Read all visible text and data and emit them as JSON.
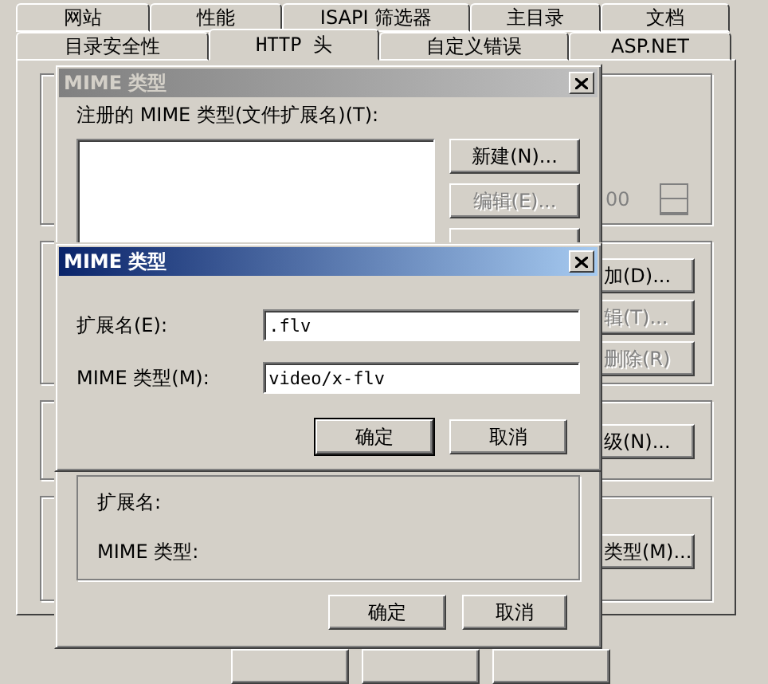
{
  "property_sheet": {
    "tabs_row1": [
      {
        "label": "网站",
        "selected": false
      },
      {
        "label": "性能",
        "selected": false
      },
      {
        "label": "ISAPI 筛选器",
        "selected": false
      },
      {
        "label": "主目录",
        "selected": false
      },
      {
        "label": "文档",
        "selected": false
      }
    ],
    "tabs_row2": [
      {
        "label": "目录安全性",
        "selected": false
      },
      {
        "label": "HTTP 头",
        "selected": true
      },
      {
        "label": "自定义错误",
        "selected": false
      },
      {
        "label": "ASP.NET",
        "selected": false
      }
    ],
    "spinner": {
      "value": "00",
      "disabled": true
    },
    "side_buttons": [
      {
        "label": "加(D)...",
        "disabled": false
      },
      {
        "label": "辑(T)...",
        "disabled": true
      },
      {
        "label": "删除(R)",
        "disabled": true
      },
      {
        "label": "级(N)...",
        "disabled": false
      },
      {
        "label": "类型(M)...",
        "disabled": false
      }
    ]
  },
  "mime_types_dialog": {
    "title": "MIME 类型",
    "active": false,
    "list_label": "注册的 MIME 类型(文件扩展名)(T):",
    "buttons": [
      {
        "label": "新建(N)...",
        "disabled": false
      },
      {
        "label": "编辑(E)...",
        "disabled": true
      }
    ],
    "details": {
      "extension_label": "扩展名:",
      "mime_label": "MIME 类型:"
    },
    "ok": "确定",
    "cancel": "取消"
  },
  "mime_type_dialog": {
    "title": "MIME 类型",
    "active": true,
    "fields": [
      {
        "label": "扩展名(E):",
        "value": ".flv"
      },
      {
        "label": "MIME 类型(M):",
        "value": "video/x-flv"
      }
    ],
    "ok": "确定",
    "cancel": "取消"
  }
}
